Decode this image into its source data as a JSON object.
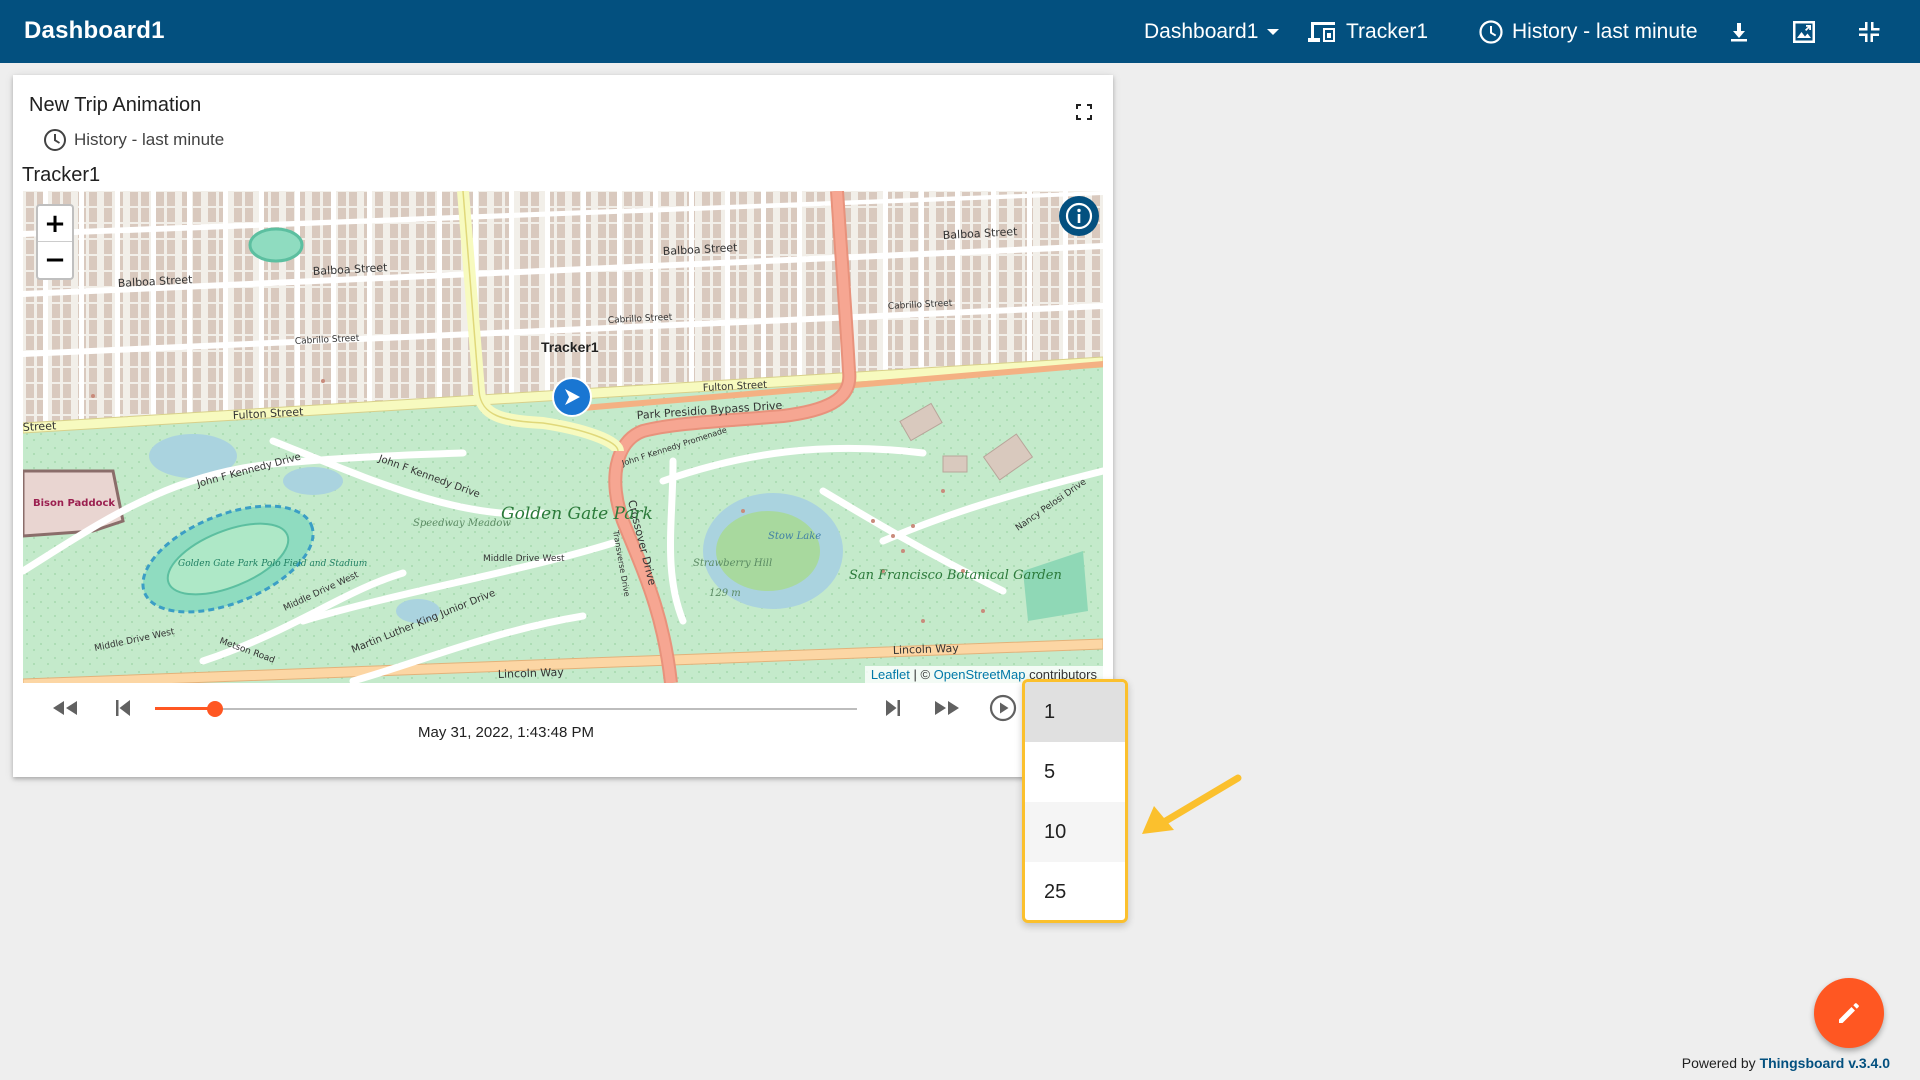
{
  "toolbar": {
    "title": "Dashboard1",
    "dashboard_select": "Dashboard1",
    "entity_alias": "Tracker1",
    "timewindow": "History - last minute",
    "icons": [
      "dropdown-arrow-icon",
      "devices-icon",
      "clock-icon",
      "download-icon",
      "image-export-icon",
      "exit-fullscreen-icon"
    ]
  },
  "widget": {
    "title": "New Trip Animation",
    "timewindow": "History - last minute",
    "device_label": "Tracker1"
  },
  "map": {
    "marker_label": "Tracker1",
    "zoom_in": "+",
    "zoom_out": "−",
    "attribution": {
      "leaflet": "Leaflet",
      "separator": " | © ",
      "osm": "OpenStreetMap",
      "suffix": " contributors"
    },
    "place_labels": {
      "golden_gate_park": "Golden Gate Park",
      "bison_paddock": "Bison Paddock",
      "botanical_garden": "San Francisco Botanical Garden",
      "polo_field": "Golden Gate Park Polo Field and Stadium",
      "strawberry_hill": "Strawberry Hill",
      "strawberry_elev": "129 m",
      "stow_lake": "Stow Lake",
      "speedway_meadow": "Speedway Meadow",
      "fulton_street": "Fulton Street",
      "fulton_street_right": "Fulton Street",
      "fulton_street_left": "Street",
      "balboa_street_1": "Balboa Street",
      "balboa_street_2": "Balboa Street",
      "balboa_street_3": "Balboa Street",
      "balboa_street_4": "Balboa Street",
      "cabrillo_street_1": "Cabrillo Street",
      "cabrillo_street_2": "Cabrillo Street",
      "cabrillo_street_3": "Cabrillo Street",
      "park_presidio": "Park Presidio Bypass Drive",
      "crossover_drive": "Crossover Drive",
      "jfk_drive_1": "John F Kennedy Drive",
      "jfk_drive_2": "John F Kennedy Drive",
      "jfk_promenade": "John F Kennedy Promenade",
      "middle_drive_west": "Middle Drive West",
      "middle_drive_west_2": "Middle Drive West",
      "middle_drive_west_3": "Middle Drive West",
      "mlk_drive": "Martin Luther King Junior Drive",
      "metson_road": "Metson Road",
      "lincoln_way_1": "Lincoln Way",
      "lincoln_way_2": "Lincoln Way",
      "nancy_pelosi": "Nancy Pelosi Drive",
      "transverse_drive": "Transverse Drive"
    }
  },
  "playback": {
    "progress": 0.085,
    "timestamp": "May 31, 2022, 1:43:48 PM",
    "icons": [
      "fast-rewind-icon",
      "skip-previous-icon",
      "skip-next-icon",
      "fast-forward-icon",
      "play-circle-icon"
    ]
  },
  "speed_menu": {
    "options": [
      "1",
      "5",
      "10",
      "25"
    ],
    "selected": "1"
  },
  "footer": {
    "prefix": "Powered by ",
    "link": "Thingsboard v.3.4.0"
  },
  "colors": {
    "toolbar_bg": "#03507f",
    "accent": "#ff5722",
    "highlight_border": "#fbc02d",
    "marker": "#1976d2"
  }
}
